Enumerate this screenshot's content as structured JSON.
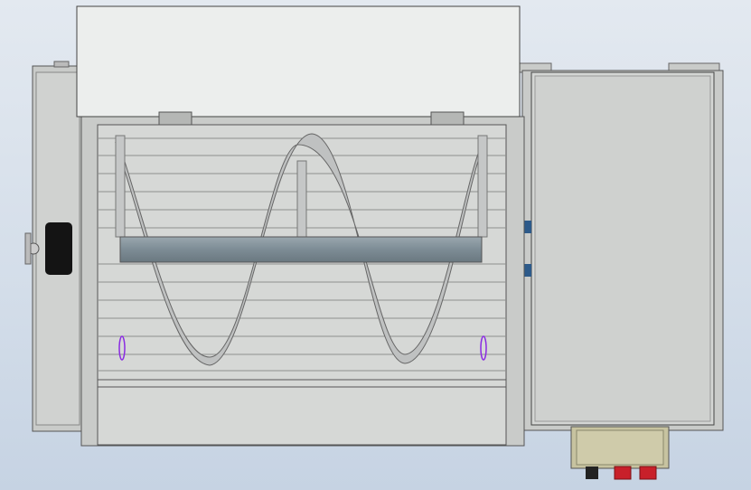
{
  "view": {
    "type": "cad-model-top-view",
    "colors": {
      "background_top": "#e3e9f0",
      "background_bottom": "#c6d3e3",
      "lid": "#eceeed",
      "body": "#c9cbc9",
      "slat": "#d6d8d6",
      "shaft": "#7f8f98",
      "spiral": "#c0c2c2",
      "control_box": "#c7c3a0",
      "button": "#c8202a",
      "handle": "#141414",
      "marker": "#8a2be2",
      "port": "#2c5a8a"
    }
  }
}
